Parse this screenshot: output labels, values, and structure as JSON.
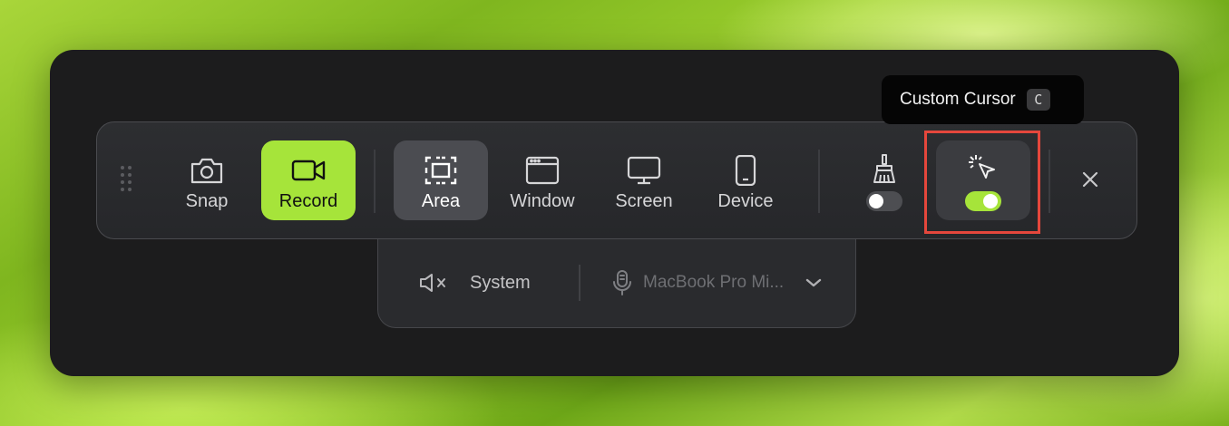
{
  "tooltip": {
    "text": "Custom Cursor",
    "shortcut": "C"
  },
  "toolbar": {
    "modes": [
      {
        "label": "Snap",
        "icon": "camera-icon"
      },
      {
        "label": "Record",
        "icon": "video-camera-icon",
        "selected": true
      }
    ],
    "capture": [
      {
        "label": "Area",
        "icon": "area-select-icon",
        "selected": true
      },
      {
        "label": "Window",
        "icon": "window-icon"
      },
      {
        "label": "Screen",
        "icon": "monitor-icon"
      },
      {
        "label": "Device",
        "icon": "phone-icon"
      }
    ],
    "toggles": [
      {
        "icon": "broom-icon",
        "on": false
      },
      {
        "icon": "custom-cursor-icon",
        "on": true
      }
    ]
  },
  "audio": {
    "system_label": "System",
    "mic_label": "MacBook Pro Mi..."
  },
  "colors": {
    "accent": "#a6e43a",
    "highlight": "#e5473c",
    "panel": "#1c1c1d"
  }
}
